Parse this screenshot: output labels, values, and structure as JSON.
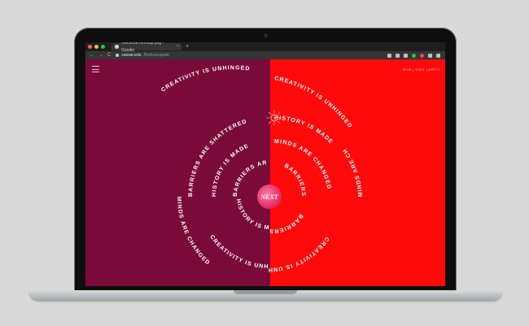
{
  "browser": {
    "tab_title": "macbook-mockup.png - Google",
    "tab_close": "×",
    "new_tab": "+",
    "nav_back": "←",
    "nav_forward": "→",
    "nav_reload": "C",
    "url_domain": "vassar.edu",
    "url_path": "/findyourspark"
  },
  "site": {
    "top_links": "give | visit | apply",
    "next_label": "NEXT",
    "ring_phrases": {
      "r1_left": "BARRIERS ARE SHATTERED",
      "r1_right": "HISTORY IS MADE",
      "r2_left": "HISTORY IS MADE",
      "r2_right": "MINDS ARE CHANGED",
      "r3_left": "BARRIERS ARE SHATTERED",
      "r3_right": "BARRIERS ARE SHATTERED",
      "r4_left": "MINDS ARE CHANGED",
      "r4_right": "MINDS ARE CHANGED",
      "r5_left": "HISTORY IS MADE",
      "r5_right": "BARRIERS ARE SHATTERED",
      "r6_left": "CREATIVITY IS UNHINGED",
      "r6_right": "CREATIVITY IS UNHINGED",
      "r7_left": "CREATIVITY IS UNHINGED",
      "r7_right": "CREATIVITY IS UNHINGED"
    }
  },
  "colors": {
    "left_bg": "#7a0a3a",
    "right_bg": "#ff0a0a",
    "next_button": "#e0265f"
  }
}
